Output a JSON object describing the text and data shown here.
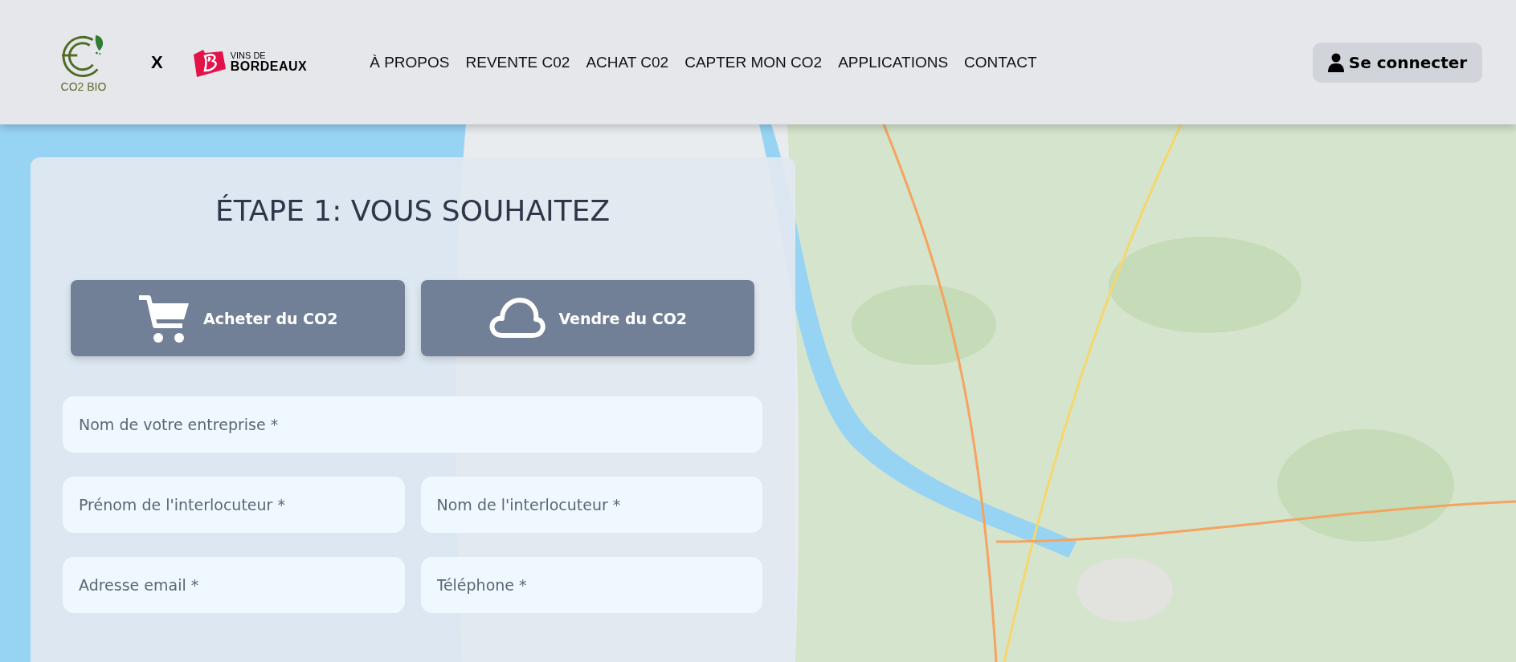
{
  "header": {
    "logo_text": "CO2 BIO",
    "separator": "X",
    "partner_logo": {
      "line_1": "VINS DE",
      "line_2": "BORDEAUX"
    },
    "nav": [
      "À PROPOS",
      "REVENTE C02",
      "ACHAT C02",
      "CAPTER MON CO2",
      "APPLICATIONS",
      "CONTACT"
    ],
    "login_button": "Se connecter"
  },
  "form": {
    "title": "ÉTAPE 1: VOUS SOUHAITEZ",
    "choices": [
      {
        "label": "Acheter du CO2",
        "kind": "cart"
      },
      {
        "label": "Vendre du CO2",
        "kind": "cloud"
      }
    ],
    "fields": [
      [
        {
          "placeholder": "Nom de votre entreprise *"
        }
      ],
      [
        {
          "placeholder": "Prénom de l'interlocuteur *"
        },
        {
          "placeholder": "Nom de l'interlocuteur *"
        }
      ],
      [
        {
          "placeholder": "Adresse email *"
        },
        {
          "placeholder": "Téléphone *"
        }
      ]
    ]
  }
}
